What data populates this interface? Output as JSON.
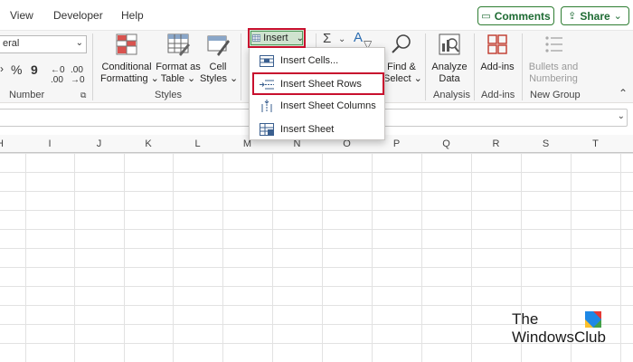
{
  "tabs": [
    "View",
    "Developer",
    "Help"
  ],
  "comments_button": "Comments",
  "share_button": "Share",
  "number_group": {
    "format_value": "eral",
    "percent": "%",
    "comma": "9",
    "label": "Number"
  },
  "styles_group": {
    "conditional": [
      "Conditional",
      "Formatting"
    ],
    "format_table": [
      "Format as",
      "Table"
    ],
    "cell_styles": [
      "Cell",
      "Styles"
    ],
    "label": "Styles"
  },
  "cells_group": {
    "insert_label": "Insert"
  },
  "editing_group": {
    "sigma": "Σ",
    "find": [
      "Find &",
      "Select"
    ]
  },
  "analysis_group": {
    "analyze": [
      "Analyze",
      "Data"
    ],
    "label": "Analysis"
  },
  "addins_group": {
    "addins": "Add-ins",
    "label": "Add-ins"
  },
  "new_group": {
    "bullets": [
      "Bullets and",
      "Numbering"
    ],
    "label": "New Group"
  },
  "insert_menu": [
    {
      "label": "Insert Cells...",
      "selected": false
    },
    {
      "label": "Insert Sheet Rows",
      "selected": true
    },
    {
      "label": "Insert Sheet Columns",
      "selected": false
    },
    {
      "label": "Insert Sheet",
      "selected": false
    }
  ],
  "columns": [
    "H",
    "I",
    "J",
    "K",
    "L",
    "M",
    "N",
    "O",
    "P",
    "Q",
    "R",
    "S",
    "T"
  ],
  "watermark": [
    "The",
    "WindowsClub"
  ],
  "colors": {
    "highlight_red": "#c8102e",
    "accent_green": "#1e6b33",
    "ribbon_bg": "#f6f6f6"
  }
}
